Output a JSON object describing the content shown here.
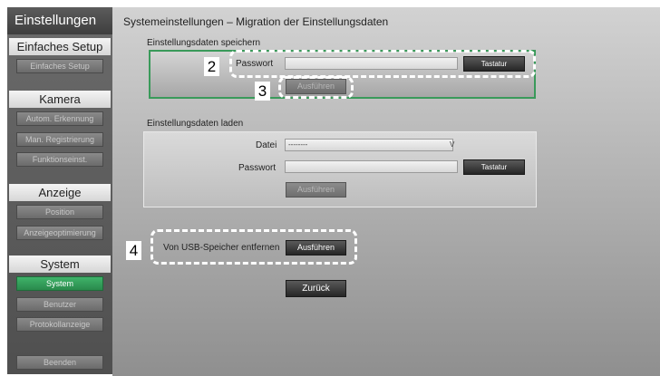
{
  "sidebar": {
    "title": "Einstellungen",
    "sections": [
      {
        "header": "Einfaches Setup",
        "items": [
          {
            "label": "Einfaches Setup"
          }
        ]
      },
      {
        "header": "Kamera",
        "items": [
          {
            "label": "Autom. Erkennung"
          },
          {
            "label": "Man. Registrierung"
          },
          {
            "label": "Funktionseinst."
          }
        ]
      },
      {
        "header": "Anzeige",
        "items": [
          {
            "label": "Position"
          },
          {
            "label": "Anzeigeoptimierung"
          }
        ]
      },
      {
        "header": "System",
        "items": [
          {
            "label": "System",
            "active": true
          },
          {
            "label": "Benutzer"
          },
          {
            "label": "Protokollanzeige"
          }
        ]
      }
    ],
    "exit_label": "Beenden"
  },
  "main": {
    "title": "Systemeinstellungen – Migration der Einstellungsdaten",
    "save": {
      "label": "Einstellungsdaten speichern",
      "password_label": "Passwort",
      "password_value": "",
      "keyboard_label": "Tastatur",
      "execute_label": "Ausführen"
    },
    "load": {
      "label": "Einstellungsdaten laden",
      "file_label": "Datei",
      "file_value": "--------",
      "file_chevron": "V",
      "password_label": "Passwort",
      "password_value": "",
      "keyboard_label": "Tastatur",
      "execute_label": "Ausführen"
    },
    "usb": {
      "label": "Von USB-Speicher entfernen",
      "execute_label": "Ausführen"
    },
    "back_label": "Zurück"
  },
  "markers": {
    "m2": "2",
    "m3": "3",
    "m4": "4"
  },
  "colors": {
    "accent_green": "#3a9a5a",
    "active_item": "#2a8a4c"
  }
}
